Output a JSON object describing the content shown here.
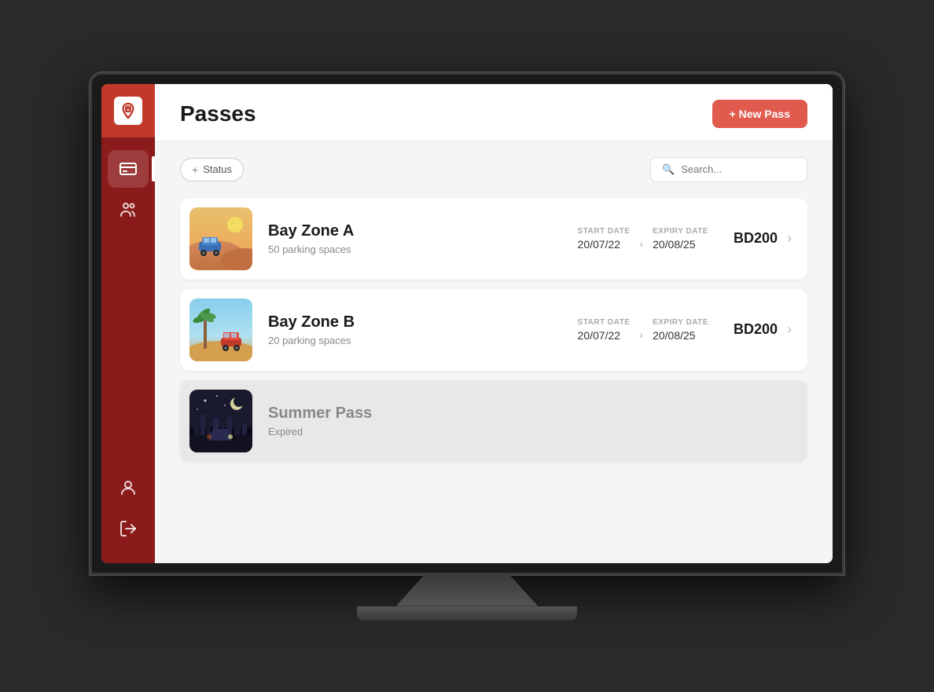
{
  "sidebar": {
    "logo_letter": "P",
    "items": [
      {
        "id": "passes",
        "label": "Passes",
        "active": true
      },
      {
        "id": "users",
        "label": "Users",
        "active": false
      }
    ],
    "bottom_items": [
      {
        "id": "profile",
        "label": "Profile"
      },
      {
        "id": "logout",
        "label": "Logout"
      }
    ]
  },
  "header": {
    "title": "Passes",
    "new_pass_button": "+ New Pass"
  },
  "filters": {
    "status_label": "Status",
    "status_plus": "+",
    "search_placeholder": "Search..."
  },
  "passes": [
    {
      "id": "bay-zone-a",
      "name": "Bay Zone A",
      "subtitle": "50 parking spaces",
      "start_date_label": "START DATE",
      "start_date": "20/07/22",
      "expiry_date_label": "EXPIRY DATE",
      "expiry_date": "20/08/25",
      "price": "BD200",
      "expired": false,
      "thumb_type": "desert"
    },
    {
      "id": "bay-zone-b",
      "name": "Bay Zone B",
      "subtitle": "20 parking spaces",
      "start_date_label": "START DATE",
      "start_date": "20/07/22",
      "expiry_date_label": "EXPIRY DATE",
      "expiry_date": "20/08/25",
      "price": "BD200",
      "expired": false,
      "thumb_type": "beach"
    },
    {
      "id": "summer-pass",
      "name": "Summer Pass",
      "subtitle": "Expired",
      "start_date_label": "",
      "start_date": "",
      "expiry_date_label": "",
      "expiry_date": "",
      "price": "",
      "expired": true,
      "thumb_type": "night"
    }
  ]
}
